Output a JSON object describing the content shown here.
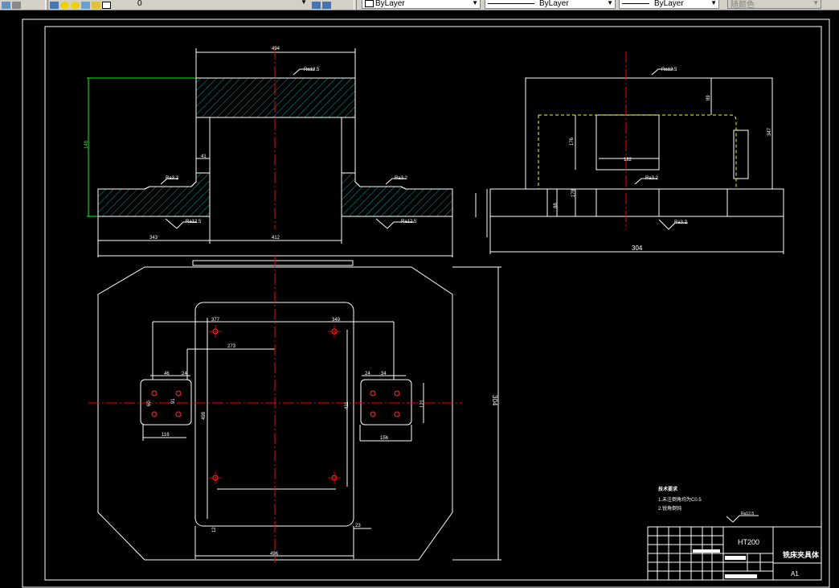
{
  "toolbar": {
    "layer_name": "0",
    "color_value": "ByLayer",
    "linetype_value": "ByLayer",
    "lineweight_value": "ByLayer",
    "plotstyle_value": "随颜色"
  },
  "drawing": {
    "front_view_dims": [
      "494",
      "148",
      "41",
      "343",
      "412"
    ],
    "side_view_dims": [
      "89",
      "347",
      "176",
      "182",
      "178",
      "88",
      "304"
    ],
    "top_view_dims": [
      "377",
      "349",
      "273",
      "498",
      "46",
      "24",
      "116",
      "156",
      "121",
      "60",
      "24",
      "34",
      "496",
      "12",
      "23",
      "304",
      "411",
      "91"
    ],
    "roughness_labels": [
      "Ra12.5",
      "Ra3.2",
      "Ra3.2",
      "Ra12.5",
      "Ra12.5",
      "Ra12.5",
      "Ra3.2",
      "Ra3.2",
      "Ra12.5",
      "Ra12.5"
    ],
    "notes_title": "技术要求",
    "notes": [
      "1.未注倒角均为C0.5",
      "2.锐角倒钝"
    ],
    "title_block": {
      "material": "HT200",
      "part_name": "铣床夹具体",
      "sheet_size": "A1"
    }
  },
  "colors": {
    "background": "#000000",
    "lines": "#ffffff",
    "centerline": "#ff0000",
    "hatch": "#00cccc",
    "dim_highlight": "#00ff00",
    "hidden": "#ffff00"
  }
}
